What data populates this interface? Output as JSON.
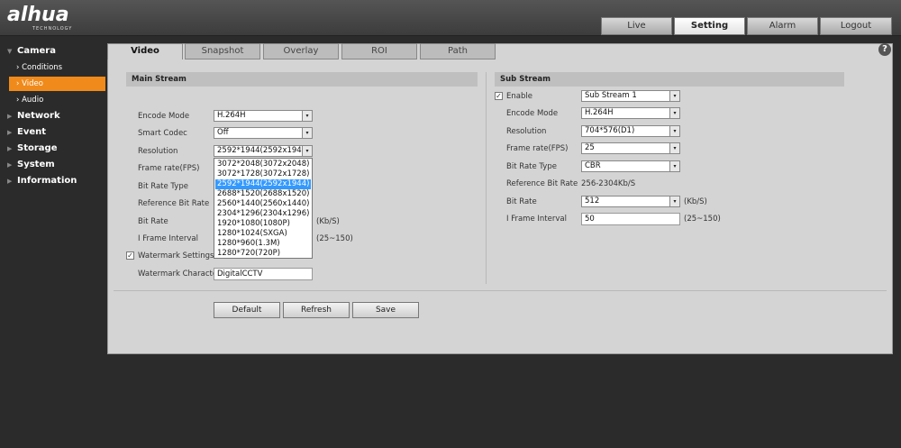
{
  "header": {
    "logo": "alhua",
    "logo_sub": "TECHNOLOGY",
    "nav": [
      "Live",
      "Setting",
      "Alarm",
      "Logout"
    ]
  },
  "sidebar": {
    "camera": "Camera",
    "camera_items": [
      "Conditions",
      "Video",
      "Audio"
    ],
    "sections": [
      "Network",
      "Event",
      "Storage",
      "System",
      "Information"
    ]
  },
  "tabs": [
    "Video",
    "Snapshot",
    "Overlay",
    "ROI",
    "Path"
  ],
  "main_stream": {
    "title": "Main Stream",
    "labels": {
      "encode_mode": "Encode Mode",
      "smart_codec": "Smart Codec",
      "resolution": "Resolution",
      "frame_rate": "Frame rate(FPS)",
      "bit_rate_type": "Bit Rate Type",
      "ref_bit_rate": "Reference Bit Rate",
      "bit_rate": "Bit Rate",
      "i_frame": "I Frame Interval",
      "watermark_settings": "Watermark Settings",
      "watermark_character": "Watermark Character"
    },
    "values": {
      "encode_mode": "H.264H",
      "smart_codec": "Off",
      "resolution": "2592*1944(2592x1944)",
      "watermark_character": "DigitalCCTV"
    },
    "bit_rate_unit": "(Kb/S)",
    "i_frame_range": "(25~150)",
    "resolution_options": [
      "3072*2048(3072x2048)",
      "3072*1728(3072x1728)",
      "2592*1944(2592x1944)",
      "2688*1520(2688x1520)",
      "2560*1440(2560x1440)",
      "2304*1296(2304x1296)",
      "1920*1080(1080P)",
      "1280*1024(SXGA)",
      "1280*960(1.3M)",
      "1280*720(720P)"
    ],
    "selected_option": 2
  },
  "sub_stream": {
    "title": "Sub Stream",
    "labels": {
      "enable": "Enable",
      "encode_mode": "Encode Mode",
      "resolution": "Resolution",
      "frame_rate": "Frame rate(FPS)",
      "bit_rate_type": "Bit Rate Type",
      "ref_bit_rate": "Reference Bit Rate",
      "bit_rate": "Bit Rate",
      "i_frame": "I Frame Interval"
    },
    "values": {
      "enable": "Sub Stream 1",
      "encode_mode": "H.264H",
      "resolution": "704*576(D1)",
      "frame_rate": "25",
      "bit_rate_type": "CBR",
      "ref_bit_rate": "256-2304Kb/S",
      "bit_rate": "512",
      "i_frame": "50"
    },
    "bit_rate_unit": "(Kb/S)",
    "i_frame_range": "(25~150)"
  },
  "buttons": {
    "default": "Default",
    "refresh": "Refresh",
    "save": "Save"
  },
  "icons": {
    "help": "?",
    "check": "✓",
    "dropdown": "▾"
  },
  "colors": {
    "accent": "#f08a1a",
    "selection": "#3399ff"
  }
}
